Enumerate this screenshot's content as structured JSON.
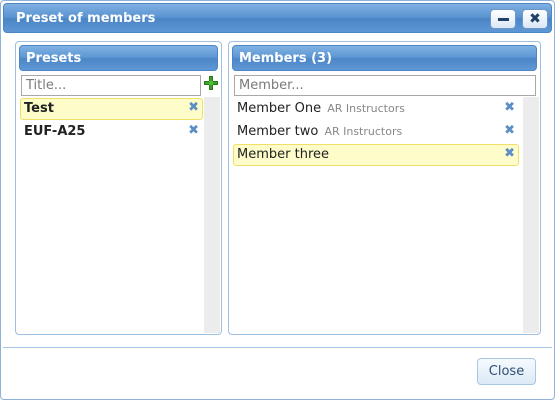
{
  "dialog": {
    "title": "Preset of members",
    "minimize_icon": "minimize-icon",
    "close_icon": "close-icon",
    "close_glyph": "✖"
  },
  "presets": {
    "header": "Presets",
    "title_placeholder": "Title...",
    "add_icon": "add-icon",
    "items": [
      {
        "name": "Test",
        "selected": true
      },
      {
        "name": "EUF-A25",
        "selected": false
      }
    ],
    "remove_glyph": "✖"
  },
  "members": {
    "header": "Members (3)",
    "member_placeholder": "Member...",
    "items": [
      {
        "name": "Member One",
        "group": "AR Instructors",
        "selected": false
      },
      {
        "name": "Member two",
        "group": "AR Instructors",
        "selected": false
      },
      {
        "name": "Member three",
        "group": "",
        "selected": true
      }
    ],
    "remove_glyph": "✖"
  },
  "footer": {
    "close_label": "Close"
  },
  "colors": {
    "title_bar": "#5a93d1",
    "selected_row": "#fefcc8",
    "remove_icon": "#5c8fc6",
    "add_icon": "#3ca12a"
  }
}
